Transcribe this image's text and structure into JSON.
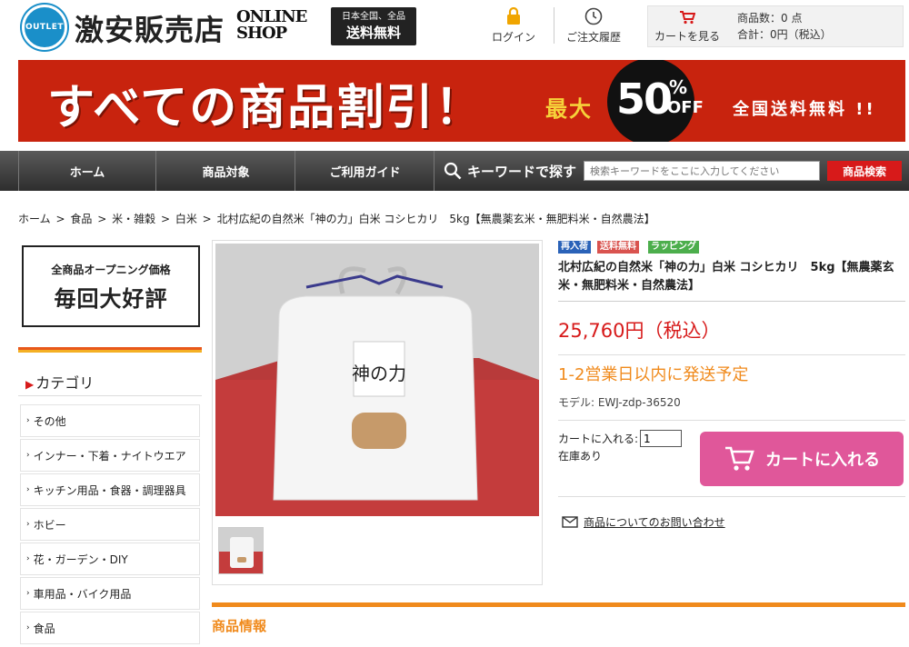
{
  "header": {
    "logo_circle_text": "OUTLET",
    "logo_name": "激安販売店",
    "logo_online": "ONLINE",
    "logo_shop": "SHOP",
    "free_badge": {
      "line1": "日本全国、全品",
      "line2": "送料無料"
    },
    "login_label": "ログイン",
    "history_label": "ご注文履歴",
    "cart_label": "カートを見る",
    "cart_count": "商品数：0 点",
    "cart_total": "合計：0円（税込）"
  },
  "banner": {
    "main": "すべての商品割引！",
    "max": "最大",
    "fifty": "50",
    "percent": "%",
    "off": "OFF",
    "free": "全国送料無料 !!"
  },
  "nav": {
    "home": "ホーム",
    "products": "商品対象",
    "guide": "ご利用ガイド",
    "keyword": "キーワードで探す",
    "search_placeholder": "検索キーワードをここに入力してください",
    "search_button": "商品検索"
  },
  "breadcrumb": [
    "ホーム",
    "食品",
    "米・雑穀",
    "白米",
    "北村広紀の自然米「神の力」白米 コシヒカリ　5kg【無農薬玄米・無肥料米・自然農法】"
  ],
  "breadcrumb_sep": ">",
  "sidebar": {
    "promo_line1": "全商品オープニング価格",
    "promo_line2": "毎回大好評",
    "category_title": "カテゴリ",
    "categories": [
      "その他",
      "インナー・下着・ナイトウエア",
      "キッチン用品・食器・調理器具",
      "ホビー",
      "花・ガーデン・DIY",
      "車用品・バイク用品",
      "食品"
    ]
  },
  "product": {
    "bag_label": "神の力",
    "badges": [
      {
        "label": "再入荷",
        "color": "#2a62b8"
      },
      {
        "label": "送料無料",
        "color": "#d9534f"
      },
      {
        "label": "ラッピング",
        "color": "#4cae4c"
      }
    ],
    "title": "北村広紀の自然米「神の力」白米 コシヒカリ　5kg【無農薬玄米・無肥料米・自然農法】",
    "price": "25,760円（税込）",
    "shipping": "1-2営業日以内に発送予定",
    "model": "モデル: EWJ-zdp-36520",
    "qty_label": "カートに入れる:",
    "qty_value": "1",
    "stock": "在庫あり",
    "add_to_cart": "カートに入れる",
    "inquiry": "商品についてのお問い合わせ"
  },
  "section": {
    "info_title": "商品情報"
  },
  "colors": {
    "accent": "#d71a1a",
    "orange": "#f08a1c",
    "cart_pink": "#e0579a",
    "brand_blue": "#1a8fc9",
    "banner_red": "#c8230e"
  }
}
